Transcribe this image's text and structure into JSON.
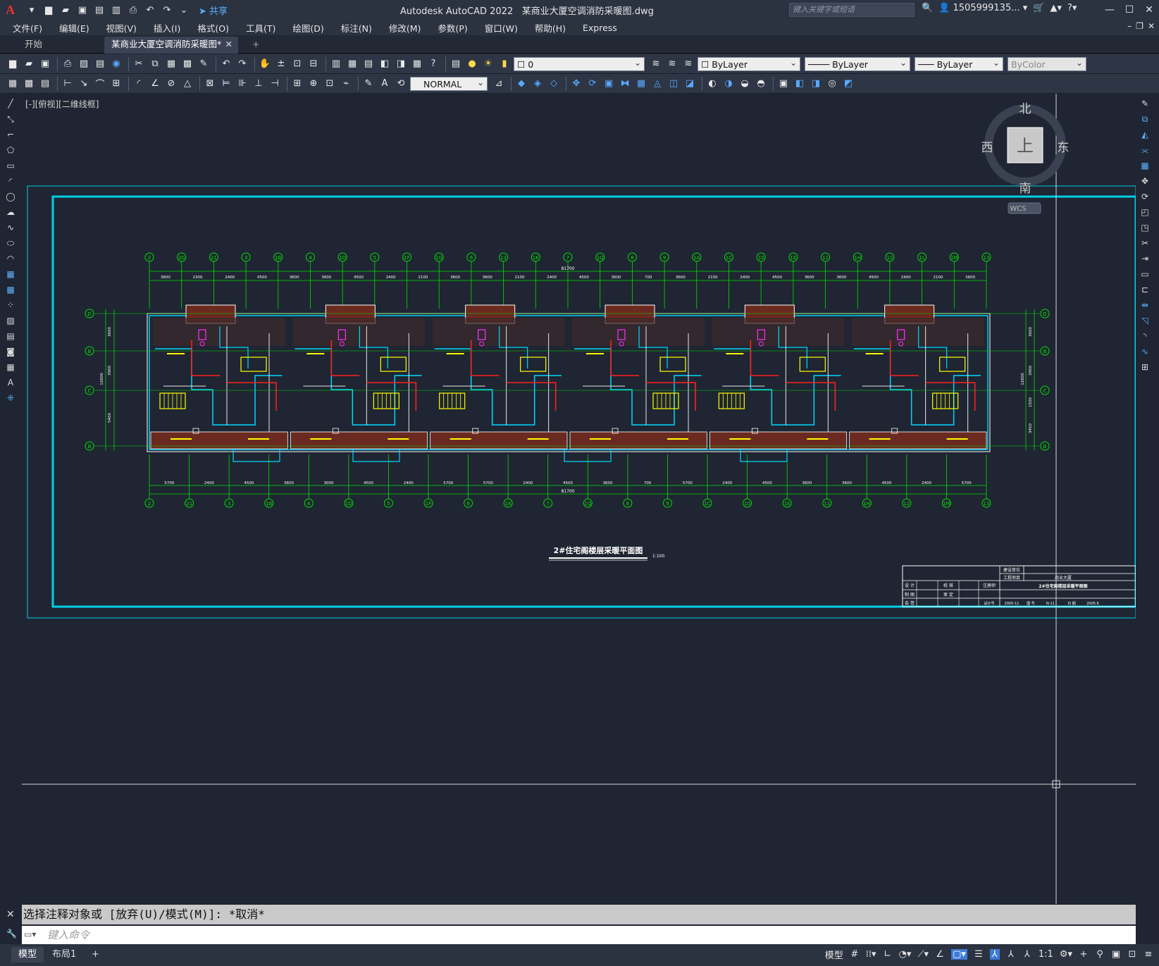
{
  "title_bar": {
    "app_name": "Autodesk AutoCAD 2022",
    "file_name": "某商业大厦空调消防采暖图.dwg",
    "search_placeholder": "键入关键字或短语",
    "user": "1505999135...",
    "share_label": "共享"
  },
  "menu": [
    "文件(F)",
    "编辑(E)",
    "视图(V)",
    "插入(I)",
    "格式(O)",
    "工具(T)",
    "绘图(D)",
    "标注(N)",
    "修改(M)",
    "参数(P)",
    "窗口(W)",
    "帮助(H)",
    "Express"
  ],
  "tabs": {
    "start": "开始",
    "document": "某商业大厦空调消防采暖图*",
    "plus": "+"
  },
  "toolbar": {
    "layer_value": "0",
    "color_value": "ByLayer",
    "linetype_value": "ByLayer",
    "lineweight_value": "ByLayer",
    "plotstyle_value": "ByColor",
    "text_style_value": "NORMAL"
  },
  "viewport_label": "[-][俯视][二维线框]",
  "viewcube": {
    "north": "北",
    "south": "南",
    "east": "东",
    "west": "西",
    "face": "上",
    "ucs": "WCS"
  },
  "drawing": {
    "plan_title": "2#住宅阁楼层采暖平面图",
    "scale": "1:100",
    "total_width_top": "81700",
    "total_width_bottom": "81700",
    "axis_labels_top": [
      "2",
      "20",
      "21",
      "3",
      "1B",
      "4",
      "1D",
      "5",
      "1F",
      "1G",
      "6",
      "12",
      "1K",
      "7",
      "1Q",
      "8",
      "9",
      "1A",
      "1C",
      "10",
      "1E",
      "11",
      "1H",
      "12",
      "1L",
      "1M",
      "13"
    ],
    "axis_labels_bottom": [
      "2",
      "21",
      "3",
      "1B",
      "4",
      "1D",
      "5",
      "1F",
      "6",
      "1K",
      "7",
      "1Q",
      "8",
      "9",
      "1C",
      "10",
      "1E",
      "11",
      "1H",
      "12",
      "1M",
      "13"
    ],
    "dims_top": [
      "3600",
      "2300",
      "2400",
      "4500",
      "3600",
      "3600",
      "4500",
      "2400",
      "2100",
      "3600",
      "3600",
      "2100",
      "2400",
      "4500",
      "3600",
      "700",
      "3600",
      "2100",
      "2400",
      "4500",
      "3600",
      "3600",
      "4500",
      "2400",
      "2100",
      "3600"
    ],
    "dims_bottom": [
      "5700",
      "2400",
      "4500",
      "3600",
      "3000",
      "4500",
      "2400",
      "5700",
      "5700",
      "2400",
      "4500",
      "3600",
      "700",
      "5700",
      "2400",
      "4500",
      "3600",
      "3600",
      "4500",
      "2400",
      "5700"
    ],
    "row_labels": [
      "D",
      "B",
      "C",
      "B"
    ],
    "row_dims_left": [
      "3600",
      "3900",
      "12600",
      "5400"
    ],
    "row_dims_right": [
      "3600",
      "3900",
      "12600",
      "1500",
      "3450"
    ]
  },
  "title_block": {
    "org": "建设单位",
    "project_label": "工程项目",
    "project_name": "商业大厦",
    "drawing_name": "2#住宅阁楼层采暖平面图",
    "rows": [
      [
        "设 计",
        "",
        "校 核",
        "",
        "注册师"
      ],
      [
        "制 图",
        "",
        "审 定",
        ""
      ],
      [
        "会 签",
        "",
        "",
        "",
        "设计号",
        "2005-11",
        "图 号",
        "N-11",
        "日 期",
        "2005.6"
      ]
    ]
  },
  "command": {
    "history": "选择注释对象或 [放弃(U)/模式(M)]: *取消*",
    "input_placeholder": "键入命令"
  },
  "status": {
    "layout_tabs": [
      "模型",
      "布局1",
      "+"
    ],
    "model_label": "模型",
    "scale": "1:1"
  },
  "colors": {
    "canvas": "#1f2532",
    "cyan": "#00d8ff",
    "green": "#00e000",
    "red": "#ff2020",
    "magenta": "#ff30ff",
    "yellow": "#ffff00",
    "brown": "#6b2a20"
  }
}
